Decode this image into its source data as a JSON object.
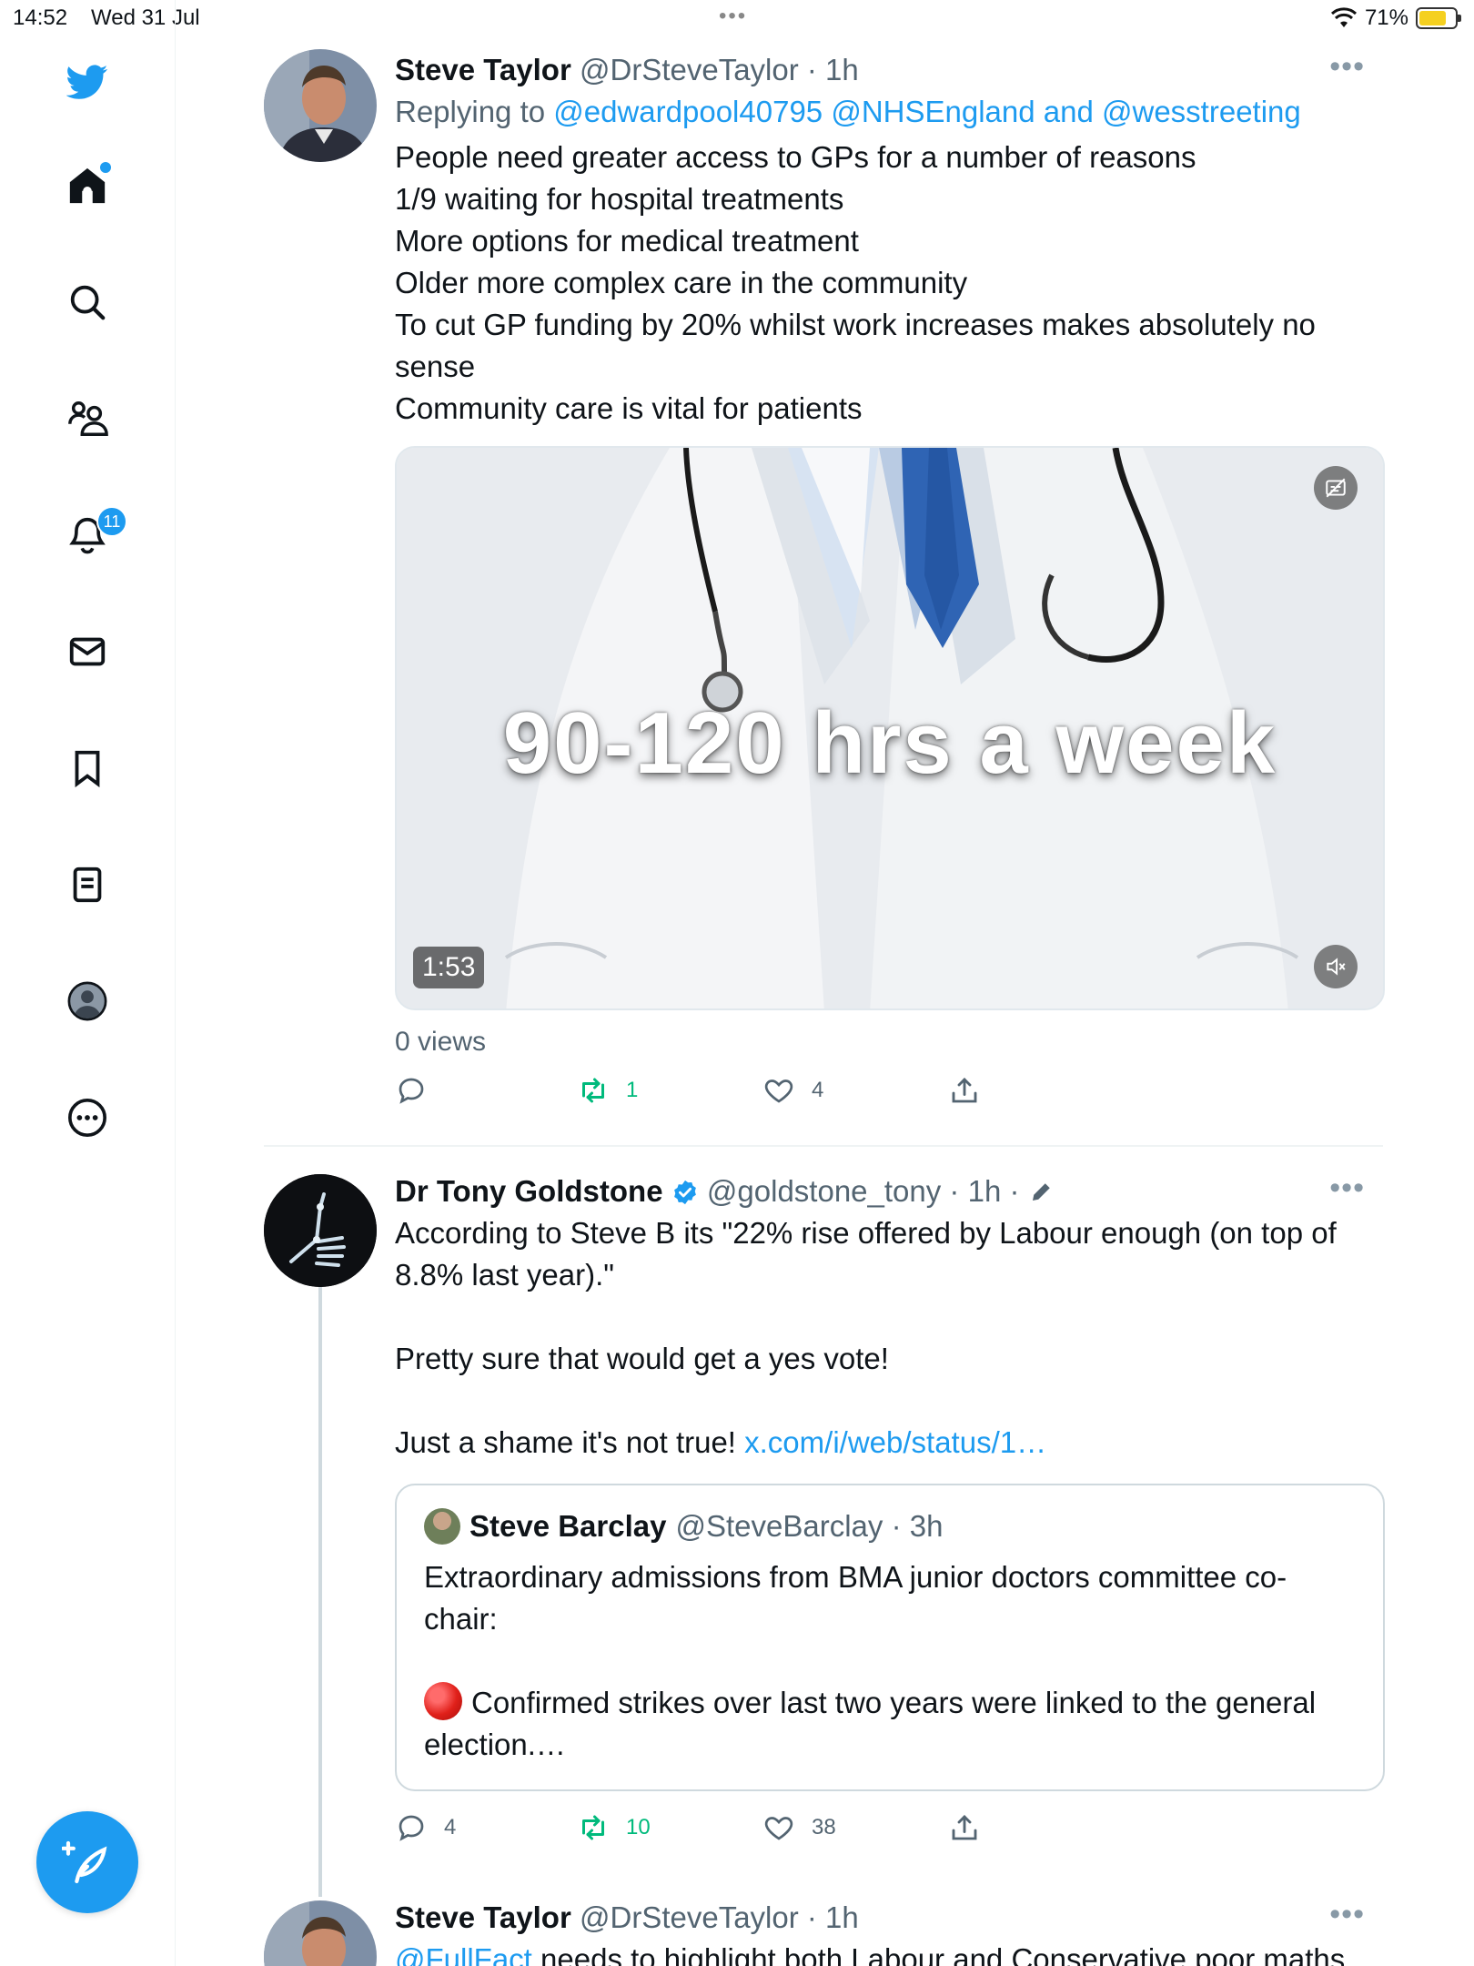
{
  "status_bar": {
    "time": "14:52",
    "date": "Wed 31 Jul",
    "battery": "71%"
  },
  "sidebar": {
    "notifications_badge": "11",
    "items": [
      "twitter-logo",
      "home",
      "search",
      "communities",
      "notifications",
      "messages",
      "bookmarks",
      "lists",
      "profile",
      "more"
    ]
  },
  "tweets": [
    {
      "name": "Steve Taylor",
      "handle": "@DrSteveTaylor",
      "sep": " · ",
      "time": "1h",
      "replying_prefix": "Replying to ",
      "replying_to": "@edwardpool40795 @NHSEngland and @wesstreeting",
      "text": "People need greater access to GPs for a number of reasons\n1/9 waiting for hospital treatments\nMore options for medical treatment\nOlder more complex care in the community\nTo cut GP funding by 20% whilst work increases makes absolutely no sense\nCommunity care is vital for patients",
      "video_caption": "90-120 hrs a week",
      "video_duration": "1:53",
      "views": "0 views",
      "replies": "",
      "retweets": "1",
      "likes": "4"
    },
    {
      "name": "Dr Tony Goldstone",
      "handle": "@goldstone_tony",
      "sep": " · ",
      "time": "1h",
      "sep2": " ·",
      "text": "According to Steve B its \"22% rise offered by Labour enough (on top of 8.8% last year).\"\n\nPretty sure that would get a yes vote!\n\nJust a shame it's not true! ",
      "link": "x.com/i/web/status/1…",
      "quote": {
        "name": "Steve Barclay",
        "handle": "@SteveBarclay",
        "sep": " · ",
        "time": "3h",
        "text": "Extraordinary admissions from BMA junior doctors committee co-chair:",
        "text2": "Confirmed strikes over last two years were linked to the general election.…"
      },
      "replies": "4",
      "retweets": "10",
      "likes": "38"
    },
    {
      "name": "Steve Taylor",
      "handle": "@DrSteveTaylor",
      "sep": " · ",
      "time": "1h",
      "text_link": "@FullFact",
      "text": " needs to highlight both Labour and Conservative poor maths"
    }
  ],
  "colors": {
    "accent": "#1d9bf0",
    "retweet": "#00ba7c",
    "muted": "#536471"
  }
}
